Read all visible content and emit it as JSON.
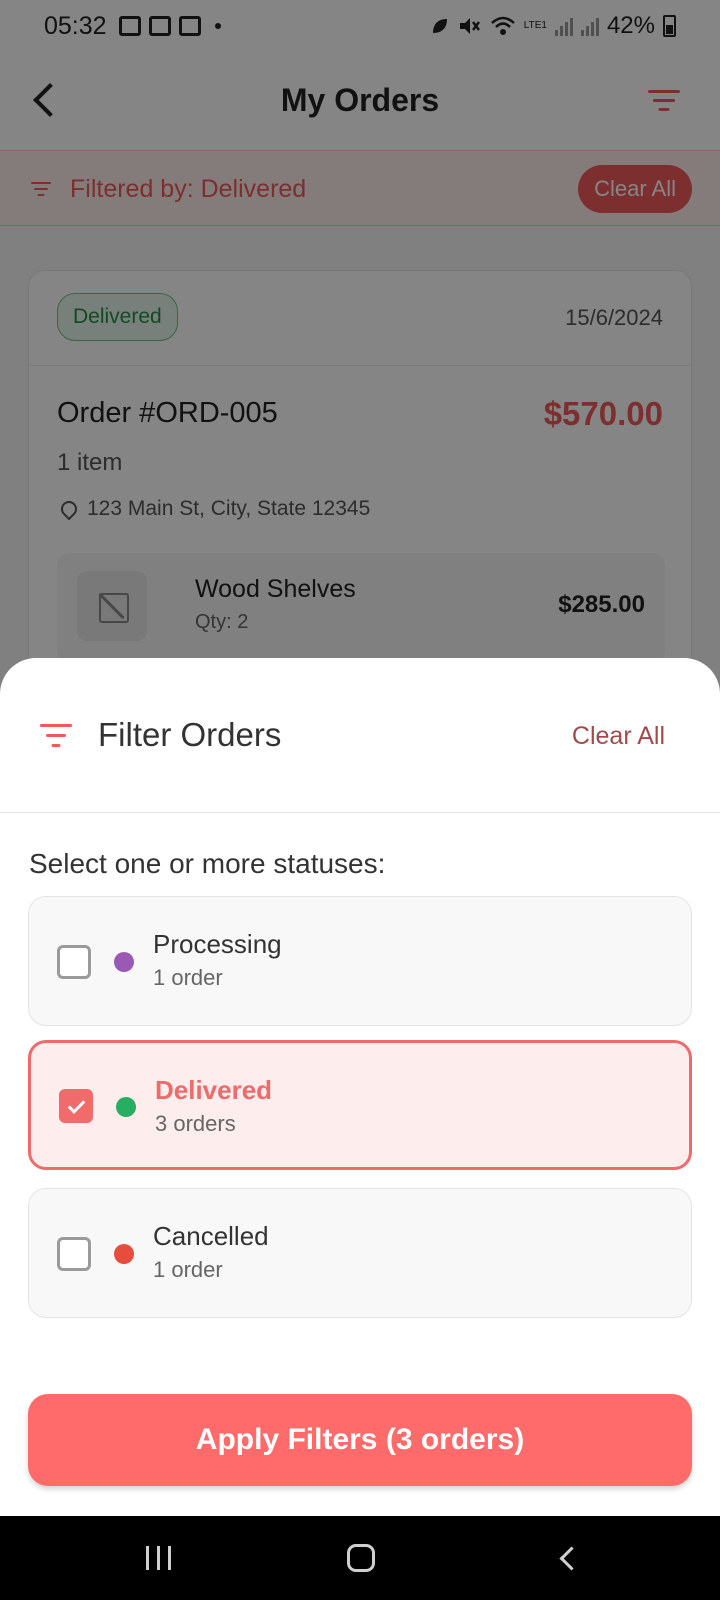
{
  "status_bar": {
    "time": "05:32",
    "network": "LTE1",
    "battery": "42%"
  },
  "app_bar": {
    "title": "My Orders"
  },
  "filter_banner": {
    "text": "Filtered by: Delivered",
    "clear_label": "Clear All"
  },
  "order": {
    "status": "Delivered",
    "date": "15/6/2024",
    "number": "Order #ORD-005",
    "total": "$570.00",
    "item_count": "1 item",
    "address": "123 Main St, City, State 12345",
    "line_item": {
      "name": "Wood Shelves",
      "qty": "Qty: 2",
      "price": "$285.00"
    }
  },
  "sheet": {
    "title": "Filter Orders",
    "clear_label": "Clear All",
    "prompt": "Select one or more statuses:",
    "options": [
      {
        "label": "Processing",
        "count": "1 order",
        "checked": false,
        "dot_color": "#9b59b6"
      },
      {
        "label": "Delivered",
        "count": "3 orders",
        "checked": true,
        "dot_color": "#27ae60"
      },
      {
        "label": "Cancelled",
        "count": "1 order",
        "checked": false,
        "dot_color": "#e74c3c"
      }
    ],
    "apply_label": "Apply Filters (3 orders)"
  },
  "colors": {
    "accent": "#ff6b6b",
    "accent_dark": "#ef5a5a",
    "success": "#27ae60"
  },
  "icons": {
    "back": "chevron-left-icon",
    "filter": "filter-icon",
    "location": "map-pin-icon",
    "image_placeholder": "image-off-icon",
    "check": "check-icon"
  }
}
